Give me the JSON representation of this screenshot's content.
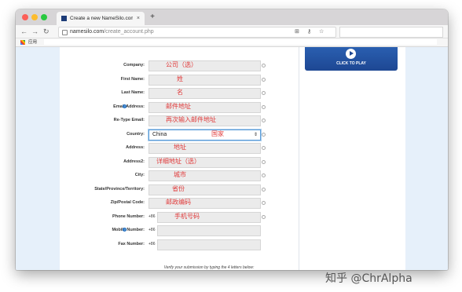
{
  "browser": {
    "tab_title": "Create a new NameSilo.com a...",
    "tab_close": "×",
    "new_tab": "+",
    "url_domain": "namesilo.com",
    "url_path": "/create_account.php",
    "bookmarks_apps": "应用"
  },
  "sidebar": {
    "video_caption": "CLICK TO PLAY"
  },
  "form": {
    "fields": [
      {
        "label": "Company:",
        "value": "公司（选）"
      },
      {
        "label": "First Name:",
        "value": "姓"
      },
      {
        "label": "Last Name:",
        "value": "名"
      },
      {
        "label": "Email Address:",
        "value": "邮件地址"
      },
      {
        "label": "Re-Type Email:",
        "value": "再次输入邮件地址"
      },
      {
        "label": "Country:",
        "value": "国家",
        "selected": "China"
      },
      {
        "label": "Address:",
        "value": "地址"
      },
      {
        "label": "Address2:",
        "value": "详细地址（选）"
      },
      {
        "label": "City:",
        "value": "城市"
      },
      {
        "label": "State/Province/Territory:",
        "value": "省份"
      },
      {
        "label": "Zip/Postal Code:",
        "value": "邮政编码"
      },
      {
        "label": "Phone Number:",
        "value": "手机号码",
        "prefix": "+86"
      },
      {
        "label": "Mobile Number:",
        "value": "",
        "prefix": "+86"
      },
      {
        "label": "Fax Number:",
        "value": "",
        "prefix": "+86"
      }
    ],
    "verify_text": "Verify your submission by typing the 4 letters below:"
  },
  "watermark": "知乎 @ChrAlpha"
}
